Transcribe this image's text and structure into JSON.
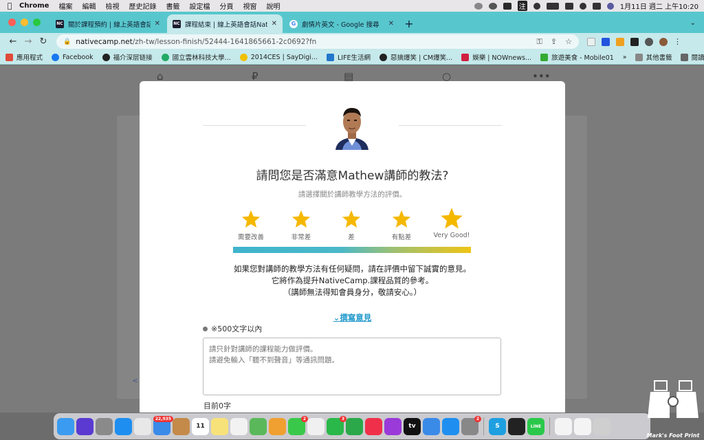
{
  "menubar": {
    "app": "Chrome",
    "items": [
      "檔案",
      "編輯",
      "檢視",
      "歷史記錄",
      "書籤",
      "設定檔",
      "分頁",
      "視窗",
      "說明"
    ],
    "input_method": "注",
    "clock": "1月11日 週二 上午10:20"
  },
  "tabs": [
    {
      "title": "關於課程預約 | 線上英語會話Nati",
      "favicon": "NC",
      "active": false
    },
    {
      "title": "課程結束 | 線上英語會話NativeC",
      "favicon": "NC",
      "active": true
    },
    {
      "title": "劇情片英文 - Google 搜尋",
      "favicon": "G",
      "active": false
    }
  ],
  "address": {
    "host": "nativecamp.net",
    "path": "/zh-tw/lesson-finish/52444-1641865661-2c0692?fn"
  },
  "bookmarks": {
    "items": [
      {
        "label": "應用程式",
        "color": "#e04a3a"
      },
      {
        "label": "Facebook",
        "color": "#1877f2"
      },
      {
        "label": "福介深层链接",
        "color": "#222222"
      },
      {
        "label": "國立雲林科技大學...",
        "color": "#22aa66"
      },
      {
        "label": "2014CES | SayDigi...",
        "color": "#f0c000"
      },
      {
        "label": "LIFE生活網",
        "color": "#2277cc"
      },
      {
        "label": "惡搞爆笑 | CM爆笑...",
        "color": "#222222"
      },
      {
        "label": "娛樂 | NOWnews...",
        "color": "#d02040"
      },
      {
        "label": "旅遊美食 - Mobile01",
        "color": "#33aa33"
      }
    ],
    "more": "»",
    "other": "其他書籤",
    "reading_list": "閱讀清單"
  },
  "page": {
    "back_link": "<"
  },
  "modal": {
    "question": "請問您是否滿意Mathew講師的教法?",
    "subtitle": "請選擇關於講師教學方法的評價。",
    "ratings": [
      {
        "label": "需要改善"
      },
      {
        "label": "非常差"
      },
      {
        "label": "差"
      },
      {
        "label": "有點差"
      },
      {
        "label": "Very Good!"
      }
    ],
    "star_color": "#f5b800",
    "note_line1": "如果您對講師的教學方法有任何疑問，請在評價中留下誠實的意見。",
    "note_line2": "它將作為提升NativeCamp.課程品質的參考。",
    "note_line3": "（講師無法得知會員身分，敬請安心。）",
    "write_comment": "撰寫意見",
    "char_limit": "※500文字以內",
    "textarea_placeholder": "請只針對講師的課程能力做評價。\n請避免輸入「聽不到聲音」等通訊問題。",
    "char_count": "目前0字"
  },
  "dock": {
    "items": [
      {
        "name": "finder-icon",
        "color": "#3a9bf0"
      },
      {
        "name": "siri-icon",
        "color": "#5a3ad0"
      },
      {
        "name": "launchpad-icon",
        "color": "#8a8a8a"
      },
      {
        "name": "safari-icon",
        "color": "#1e8ff0"
      },
      {
        "name": "chrome-icon",
        "color": "#e8e8e8"
      },
      {
        "name": "mail-icon",
        "color": "#3a8ae8",
        "badge": "22,935"
      },
      {
        "name": "contacts-icon",
        "color": "#c48a4a"
      },
      {
        "name": "calendar-icon",
        "color": "#ffffff",
        "text": "11"
      },
      {
        "name": "notes-icon",
        "color": "#f7e27a"
      },
      {
        "name": "reminders-icon",
        "color": "#f2f2f2"
      },
      {
        "name": "maps-icon",
        "color": "#5ab85a"
      },
      {
        "name": "photos-icon",
        "color": "#f0a030"
      },
      {
        "name": "messages-icon",
        "color": "#3ac84a",
        "badge": "2"
      },
      {
        "name": "freeform-icon",
        "color": "#f0f0f0"
      },
      {
        "name": "facetime-icon",
        "color": "#2ab84a",
        "badge": "3"
      },
      {
        "name": "numbers-icon",
        "color": "#2aa84a"
      },
      {
        "name": "music-icon",
        "color": "#f0304a"
      },
      {
        "name": "podcasts-icon",
        "color": "#9a3ad8"
      },
      {
        "name": "tv-icon",
        "color": "#111111",
        "text": "tv"
      },
      {
        "name": "keynote-icon",
        "color": "#3a8ae8"
      },
      {
        "name": "appstore-icon",
        "color": "#1e8ff0"
      },
      {
        "name": "system-preferences-icon",
        "color": "#888888",
        "badge": "2"
      },
      {
        "name": "skype-icon",
        "color": "#1ea0e0",
        "text": "S"
      },
      {
        "name": "activity-monitor-icon",
        "color": "#222222"
      },
      {
        "name": "line-icon",
        "color": "#2ac84a",
        "text": "LINE"
      },
      {
        "name": "document-icon",
        "color": "#f4f4f4"
      },
      {
        "name": "screenshot-icon",
        "color": "#f4f4f4"
      },
      {
        "name": "trash-icon",
        "color": "#cfcfcf"
      }
    ]
  },
  "watermark": "Mark's Foot Print"
}
